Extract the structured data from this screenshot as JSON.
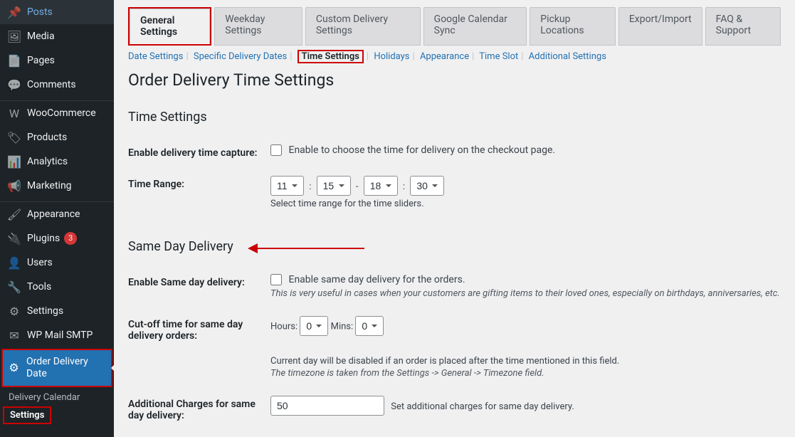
{
  "sidebar": {
    "items": [
      {
        "icon_name": "pin-icon",
        "glyph": "📌",
        "label": "Posts"
      },
      {
        "icon_name": "media-icon",
        "glyph": "🖼",
        "label": "Media"
      },
      {
        "icon_name": "pages-icon",
        "glyph": "📄",
        "label": "Pages"
      },
      {
        "icon_name": "comments-icon",
        "glyph": "💬",
        "label": "Comments"
      }
    ],
    "items2": [
      {
        "icon_name": "woo-icon",
        "glyph": "W",
        "label": "WooCommerce"
      },
      {
        "icon_name": "products-icon",
        "glyph": "🏷",
        "label": "Products"
      },
      {
        "icon_name": "analytics-icon",
        "glyph": "📊",
        "label": "Analytics"
      },
      {
        "icon_name": "marketing-icon",
        "glyph": "📢",
        "label": "Marketing"
      }
    ],
    "items3": [
      {
        "icon_name": "appearance-icon",
        "glyph": "🖌",
        "label": "Appearance"
      },
      {
        "icon_name": "plugins-icon",
        "glyph": "🔌",
        "label": "Plugins",
        "badge": "3"
      },
      {
        "icon_name": "users-icon",
        "glyph": "👤",
        "label": "Users"
      },
      {
        "icon_name": "tools-icon",
        "glyph": "🔧",
        "label": "Tools"
      },
      {
        "icon_name": "settings-icon",
        "glyph": "⚙",
        "label": "Settings"
      },
      {
        "icon_name": "mail-icon",
        "glyph": "✉",
        "label": "WP Mail SMTP"
      }
    ],
    "active": {
      "icon_name": "gear-icon",
      "glyph": "⚙",
      "label": "Order Delivery Date"
    },
    "submenu": [
      {
        "label": "Delivery Calendar"
      },
      {
        "label": "Settings"
      }
    ]
  },
  "tabs": [
    {
      "label": "General Settings"
    },
    {
      "label": "Weekday Settings"
    },
    {
      "label": "Custom Delivery Settings"
    },
    {
      "label": "Google Calendar Sync"
    },
    {
      "label": "Pickup Locations"
    },
    {
      "label": "Export/Import"
    },
    {
      "label": "FAQ & Support"
    }
  ],
  "subnav": [
    {
      "label": "Date Settings"
    },
    {
      "label": "Specific Delivery Dates"
    },
    {
      "label": "Time Settings"
    },
    {
      "label": "Holidays"
    },
    {
      "label": "Appearance"
    },
    {
      "label": "Time Slot"
    },
    {
      "label": "Additional Settings"
    }
  ],
  "page": {
    "title": "Order Delivery Time Settings",
    "section1_title": "Time Settings",
    "section2_title": "Same Day Delivery",
    "fields": {
      "enable_time": {
        "label": "Enable delivery time capture:",
        "text": "Enable to choose the time for delivery on the checkout page."
      },
      "time_range": {
        "label": "Time Range:",
        "h1": "11",
        "m1": "15",
        "h2": "18",
        "m2": "30",
        "desc": "Select time range for the time sliders."
      },
      "same_day": {
        "label": "Enable Same day delivery:",
        "text": "Enable same day delivery for the orders.",
        "desc": "This is very useful in cases when your customers are gifting items to their loved ones, especially on birthdays, anniversaries, etc."
      },
      "cutoff": {
        "label": "Cut-off time for same day delivery orders:",
        "hours_label": "Hours:",
        "mins_label": "Mins:",
        "hours": "0",
        "mins": "0",
        "note1": "Current day will be disabled if an order is placed after the time mentioned in this field.",
        "note2": "The timezone is taken from the Settings -> General -> Timezone field."
      },
      "charges": {
        "label": "Additional Charges for same day delivery:",
        "value": "50",
        "text": "Set additional charges for same day delivery."
      }
    }
  }
}
